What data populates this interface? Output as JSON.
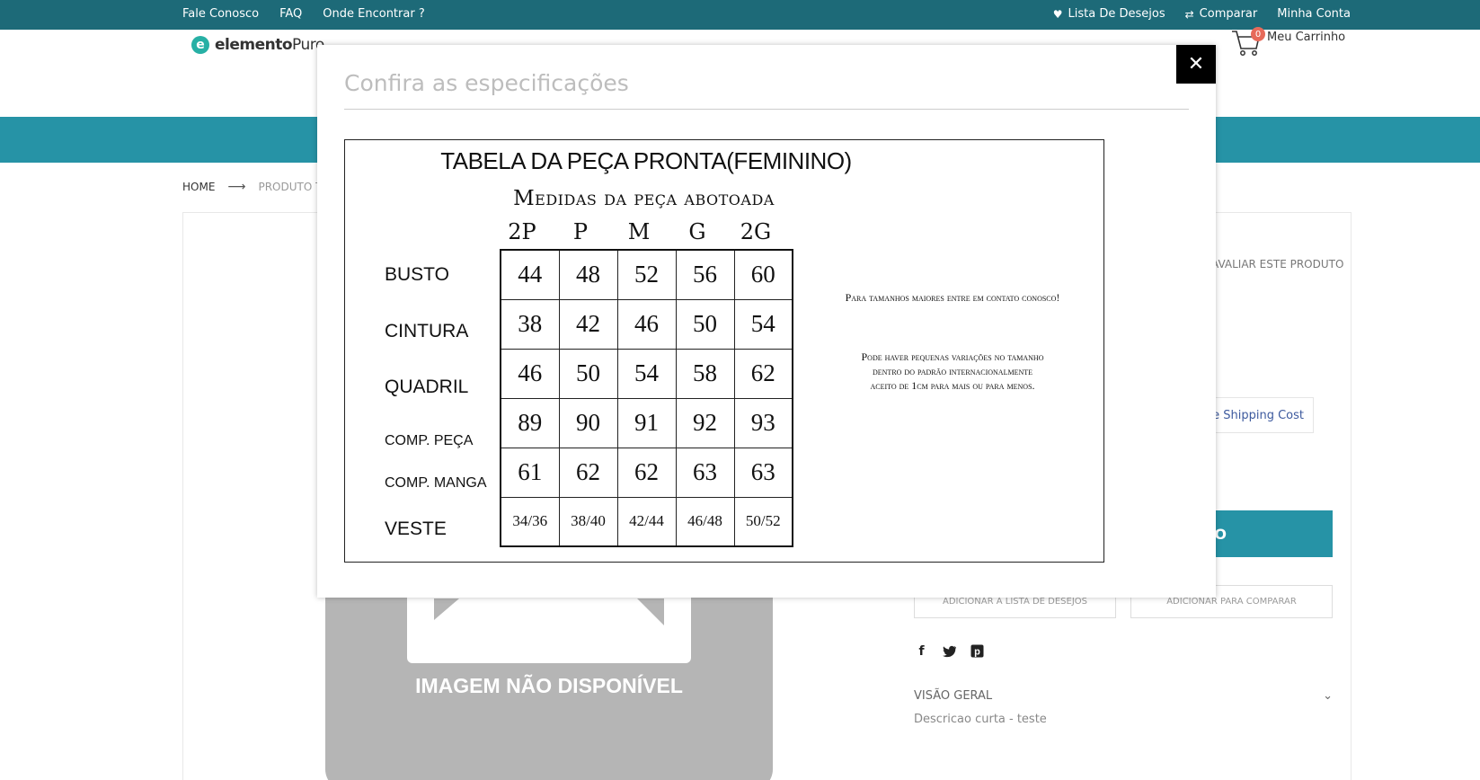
{
  "topbar": {
    "links": [
      "Fale Conosco",
      "FAQ",
      "Onde Encontrar ?"
    ],
    "wishlist": "Lista De Desejos",
    "compare": "Comparar",
    "account": "Minha Conta"
  },
  "header": {
    "logo_bold": "elemento",
    "logo_light": "Puro",
    "cart_count": "0",
    "cart_label": "Meu Carrinho"
  },
  "breadcrumb": {
    "home": "HOME",
    "current": "PRODUTO TES"
  },
  "product": {
    "no_image_text": "IMAGEM NÃO DISPONÍVEL",
    "review_link": "AVALIAR ESTE PRODUTO",
    "shipping_link": "e Shipping Cost",
    "buy_label": "O",
    "wishlist_button": "ADICIONAR À LISTA DE DESEJOS",
    "compare_button": "ADICIONAR PARA COMPARAR",
    "overview_label": "VISÃO GERAL",
    "short_description": "Descricao curta - teste"
  },
  "modal": {
    "title": "Confira as especificações",
    "close_icon": "close-icon",
    "spec": {
      "title": "TABELA DA PEÇA PRONTA(FEMININO)",
      "subtitle": "Medidas da peça abotoada",
      "sizes": [
        "2P",
        "P",
        "M",
        "G",
        "2G"
      ],
      "rows": [
        {
          "label": "BUSTO",
          "values": [
            "44",
            "48",
            "52",
            "56",
            "60"
          ]
        },
        {
          "label": "CINTURA",
          "values": [
            "38",
            "42",
            "46",
            "50",
            "54"
          ]
        },
        {
          "label": "QUADRIL",
          "values": [
            "46",
            "50",
            "54",
            "58",
            "62"
          ]
        },
        {
          "label": "COMP. PEÇA",
          "values": [
            "89",
            "90",
            "91",
            "92",
            "93"
          ]
        },
        {
          "label": "COMP. MANGA",
          "values": [
            "61",
            "62",
            "62",
            "63",
            "63"
          ]
        },
        {
          "label": "VESTE",
          "values": [
            "34/36",
            "38/40",
            "42/44",
            "46/48",
            "50/52"
          ]
        }
      ],
      "note1": "Para tamanhos maiores entre em contato conosco!",
      "note2_line1": "Pode haver pequenas variações no tamanho",
      "note2_line2": "dentro do padrão internacionalmente",
      "note2_line3": "aceito de 1cm para mais ou para menos."
    }
  },
  "colors": {
    "topbar": "#1d6a78",
    "navbar": "#2693a6",
    "accent": "#27b0a5",
    "cart_badge": "#e76a5a"
  }
}
